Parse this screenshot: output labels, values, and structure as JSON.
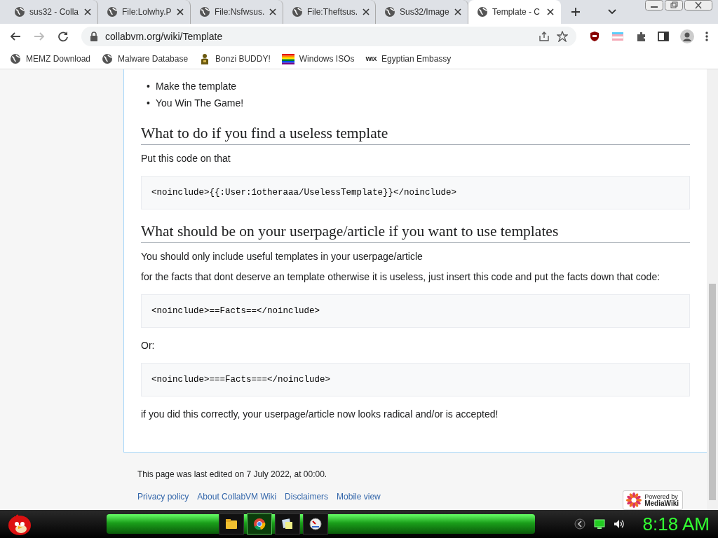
{
  "tabs": [
    {
      "title": "sus32 - Colla",
      "selected": false
    },
    {
      "title": "File:Lolwhy.P",
      "selected": false
    },
    {
      "title": "File:Nsfwsus.",
      "selected": false
    },
    {
      "title": "File:Theftsus.",
      "selected": false
    },
    {
      "title": "Sus32/Image",
      "selected": false
    },
    {
      "title": "Template - C",
      "selected": true
    }
  ],
  "address_bar": {
    "url": "collabvm.org/wiki/Template"
  },
  "bookmarks": [
    {
      "label": "MEMZ Download",
      "kind": "globe"
    },
    {
      "label": "Malware Database",
      "kind": "globe"
    },
    {
      "label": "Bonzi BUDDY!",
      "kind": "bonzi"
    },
    {
      "label": "Windows ISOs",
      "kind": "rainbow"
    },
    {
      "label": "Egyptian Embassy",
      "kind": "wix",
      "logo_text": "WIX"
    }
  ],
  "article": [
    {
      "kind": "bullet",
      "marker": "•",
      "text": "Make the template"
    },
    {
      "kind": "bullet",
      "marker": "•",
      "text": "You Win The Game!"
    },
    {
      "kind": "heading",
      "text": "What to do if you find a useless template"
    },
    {
      "kind": "paragraph",
      "text": "Put this code on that"
    },
    {
      "kind": "code",
      "text": "<noinclude>{{:User:1otheraaa/UselessTemplate}}</noinclude>"
    },
    {
      "kind": "heading",
      "text": "What should be on your userpage/article if you want to use templates"
    },
    {
      "kind": "paragraph",
      "text": "You should only include useful templates in your userpage/article"
    },
    {
      "kind": "paragraph",
      "text": "for the facts that dont deserve an template otherwise it is useless, just insert this code and put the facts down that code:"
    },
    {
      "kind": "code",
      "text": "<noinclude>==Facts==</noinclude>"
    },
    {
      "kind": "paragraph",
      "text": "Or:"
    },
    {
      "kind": "code",
      "text": "<noinclude>===Facts===</noinclude>"
    },
    {
      "kind": "paragraph",
      "text": "if you did this correctly, your userpage/article now looks radical and/or is accepted!"
    }
  ],
  "footer": {
    "last_edited": "This page was last edited on 7 July 2022, at 00:00.",
    "links": [
      "Privacy policy",
      "About CollabVM Wiki",
      "Disclaimers",
      "Mobile view"
    ],
    "badge": {
      "line_1": "Powered by",
      "line_2": "MediaWiki"
    }
  },
  "taskbar": {
    "apps": [
      {
        "kind": "folder",
        "selected": false
      },
      {
        "kind": "chrome",
        "selected": true
      },
      {
        "kind": "notes",
        "selected": false
      },
      {
        "kind": "gauge",
        "selected": false
      }
    ],
    "clock": "8:18 AM"
  }
}
